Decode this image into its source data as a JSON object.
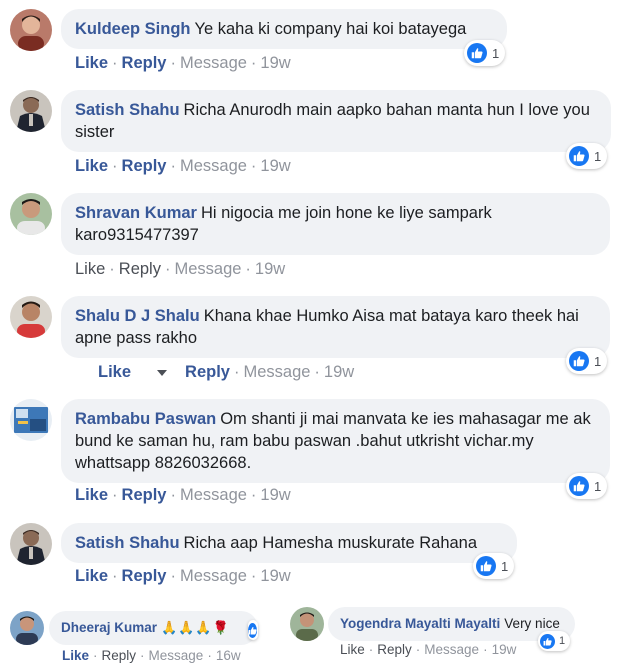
{
  "comments": [
    {
      "author": "Kuldeep Singh",
      "text": "Ye kaha ki company hai koi batayega",
      "like": "Like",
      "reply": "Reply",
      "message": "Message",
      "time": "19w",
      "reaction_count": "1"
    },
    {
      "author": "Satish Shahu",
      "text": "Richa Anurodh main aapko bahan manta hun I love you sister",
      "like": "Like",
      "reply": "Reply",
      "message": "Message",
      "time": "19w",
      "reaction_count": "1"
    },
    {
      "author": "Shravan Kumar",
      "text": "Hi nigocia me join hone ke liye sampark karo9315477397",
      "like": "Like",
      "reply": "Reply",
      "message": "Message",
      "time": "19w"
    },
    {
      "author": "Shalu D J Shalu",
      "text": "Khana khae Humko Aisa mat bataya karo theek hai apne pass rakho",
      "like": "Like",
      "reply": "Reply",
      "message": "Message",
      "time": "19w",
      "reaction_count": "1"
    },
    {
      "author": "Rambabu Paswan",
      "text": "Om shanti ji mai manvata ke ies mahasagar me ak bund ke saman hu, ram babu paswan .bahut utkrisht vichar.my whattsapp 8826032668.",
      "like": "Like",
      "reply": "Reply",
      "message": "Message",
      "time": "19w",
      "reaction_count": "1"
    },
    {
      "author": "Satish Shahu",
      "text": "Richa aap Hamesha muskurate Rahana",
      "like": "Like",
      "reply": "Reply",
      "message": "Message",
      "time": "19w",
      "reaction_count": "1"
    },
    {
      "author": "Dheeraj Kumar",
      "text": "🙏🙏🙏🌹",
      "like": "Like",
      "reply": "Reply",
      "message": "Message",
      "time": "16w"
    },
    {
      "author": "Yogendra Mayalti Mayalti",
      "text": "Very nice",
      "like": "Like",
      "reply": "Reply",
      "message": "Message",
      "time": "19w",
      "reaction_count": "1"
    }
  ],
  "separator": "·",
  "icons": {
    "reaction": "thumbs-up-icon",
    "menu": "caret-down-icon"
  },
  "colors": {
    "author": "#385898",
    "bubble": "#f0f2f5",
    "like_blue": "#1877f2",
    "meta": "#90949c"
  }
}
